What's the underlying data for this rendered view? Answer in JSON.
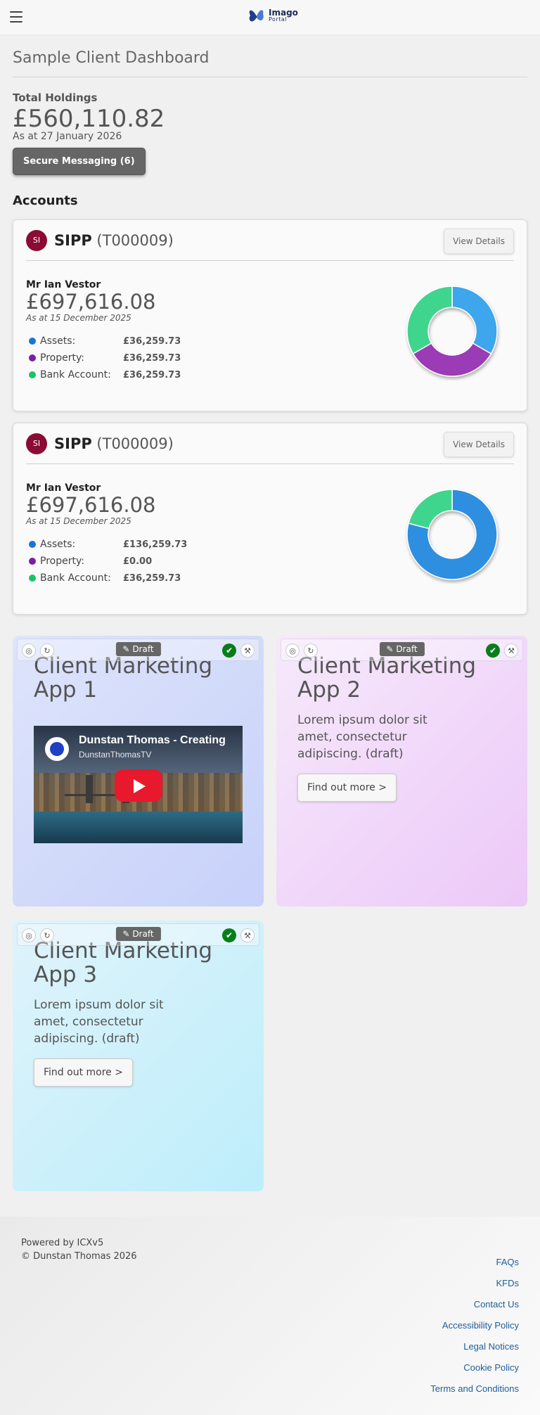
{
  "header": {
    "logo_name": "Imago",
    "logo_sub": "Portal"
  },
  "page": {
    "title": "Sample Client Dashboard"
  },
  "holdings": {
    "label": "Total Holdings",
    "value": "£560,110.82",
    "date": "As at 27 January 2026",
    "messaging_button": "Secure Messaging (6)"
  },
  "accounts_title": "Accounts",
  "accounts": [
    {
      "badge": "SI",
      "type": "SIPP",
      "code": "(T000009)",
      "view_button": "View Details",
      "holder": "Mr Ian Vestor",
      "value": "£697,616.08",
      "date": "As at 15 December 2025",
      "rows": [
        {
          "label": "Assets:",
          "value": "£36,259.73",
          "color": "#1a73d8"
        },
        {
          "label": "Property:",
          "value": "£36,259.73",
          "color": "#7b1fa2"
        },
        {
          "label": "Bank Account:",
          "value": "£36,259.73",
          "color": "#19c463"
        }
      ],
      "donut_segments": [
        {
          "name": "Assets",
          "share": 0.3333,
          "color": "#3ea6ec"
        },
        {
          "name": "Property",
          "share": 0.3333,
          "color": "#9b3ab5"
        },
        {
          "name": "Bank Account",
          "share": 0.3334,
          "color": "#3fd58c"
        }
      ]
    },
    {
      "badge": "SI",
      "type": "SIPP",
      "code": "(T000009)",
      "view_button": "View Details",
      "holder": "Mr Ian Vestor",
      "value": "£697,616.08",
      "date": "As at 15 December 2025",
      "rows": [
        {
          "label": "Assets:",
          "value": "£136,259.73",
          "color": "#1a73d8"
        },
        {
          "label": "Property:",
          "value": "£0.00",
          "color": "#7b1fa2"
        },
        {
          "label": "Bank Account:",
          "value": "£36,259.73",
          "color": "#19c463"
        }
      ],
      "donut_segments": [
        {
          "name": "Assets",
          "share": 0.79,
          "color": "#2f8fe0"
        },
        {
          "name": "Property",
          "share": 0.0,
          "color": "#9b3ab5"
        },
        {
          "name": "Bank Account",
          "share": 0.21,
          "color": "#3fd58c"
        }
      ]
    }
  ],
  "tiles": [
    {
      "draft_label": "Draft",
      "title_line1": "Client Marketing",
      "title_line2": "App 1",
      "video": {
        "title": "Dunstan Thomas - Creating",
        "channel": "DunstanThomasTV"
      }
    },
    {
      "draft_label": "Draft",
      "title_line1": "Client Marketing",
      "title_line2": "App 2",
      "text": "Lorem ipsum dolor sit amet, consectetur adipiscing. (draft)",
      "button": "Find out more >"
    },
    {
      "draft_label": "Draft",
      "title_line1": "Client Marketing",
      "title_line2": "App 3",
      "text": "Lorem ipsum dolor sit amet, consectetur adipiscing. (draft)",
      "button": "Find out more >"
    }
  ],
  "footer": {
    "powered": "Powered by ICXv5",
    "copyright": "© Dunstan Thomas 2026",
    "links": [
      "FAQs",
      "KFDs",
      "Contact Us",
      "Accessibility Policy",
      "Legal Notices",
      "Cookie Policy",
      "Terms and Conditions"
    ]
  }
}
